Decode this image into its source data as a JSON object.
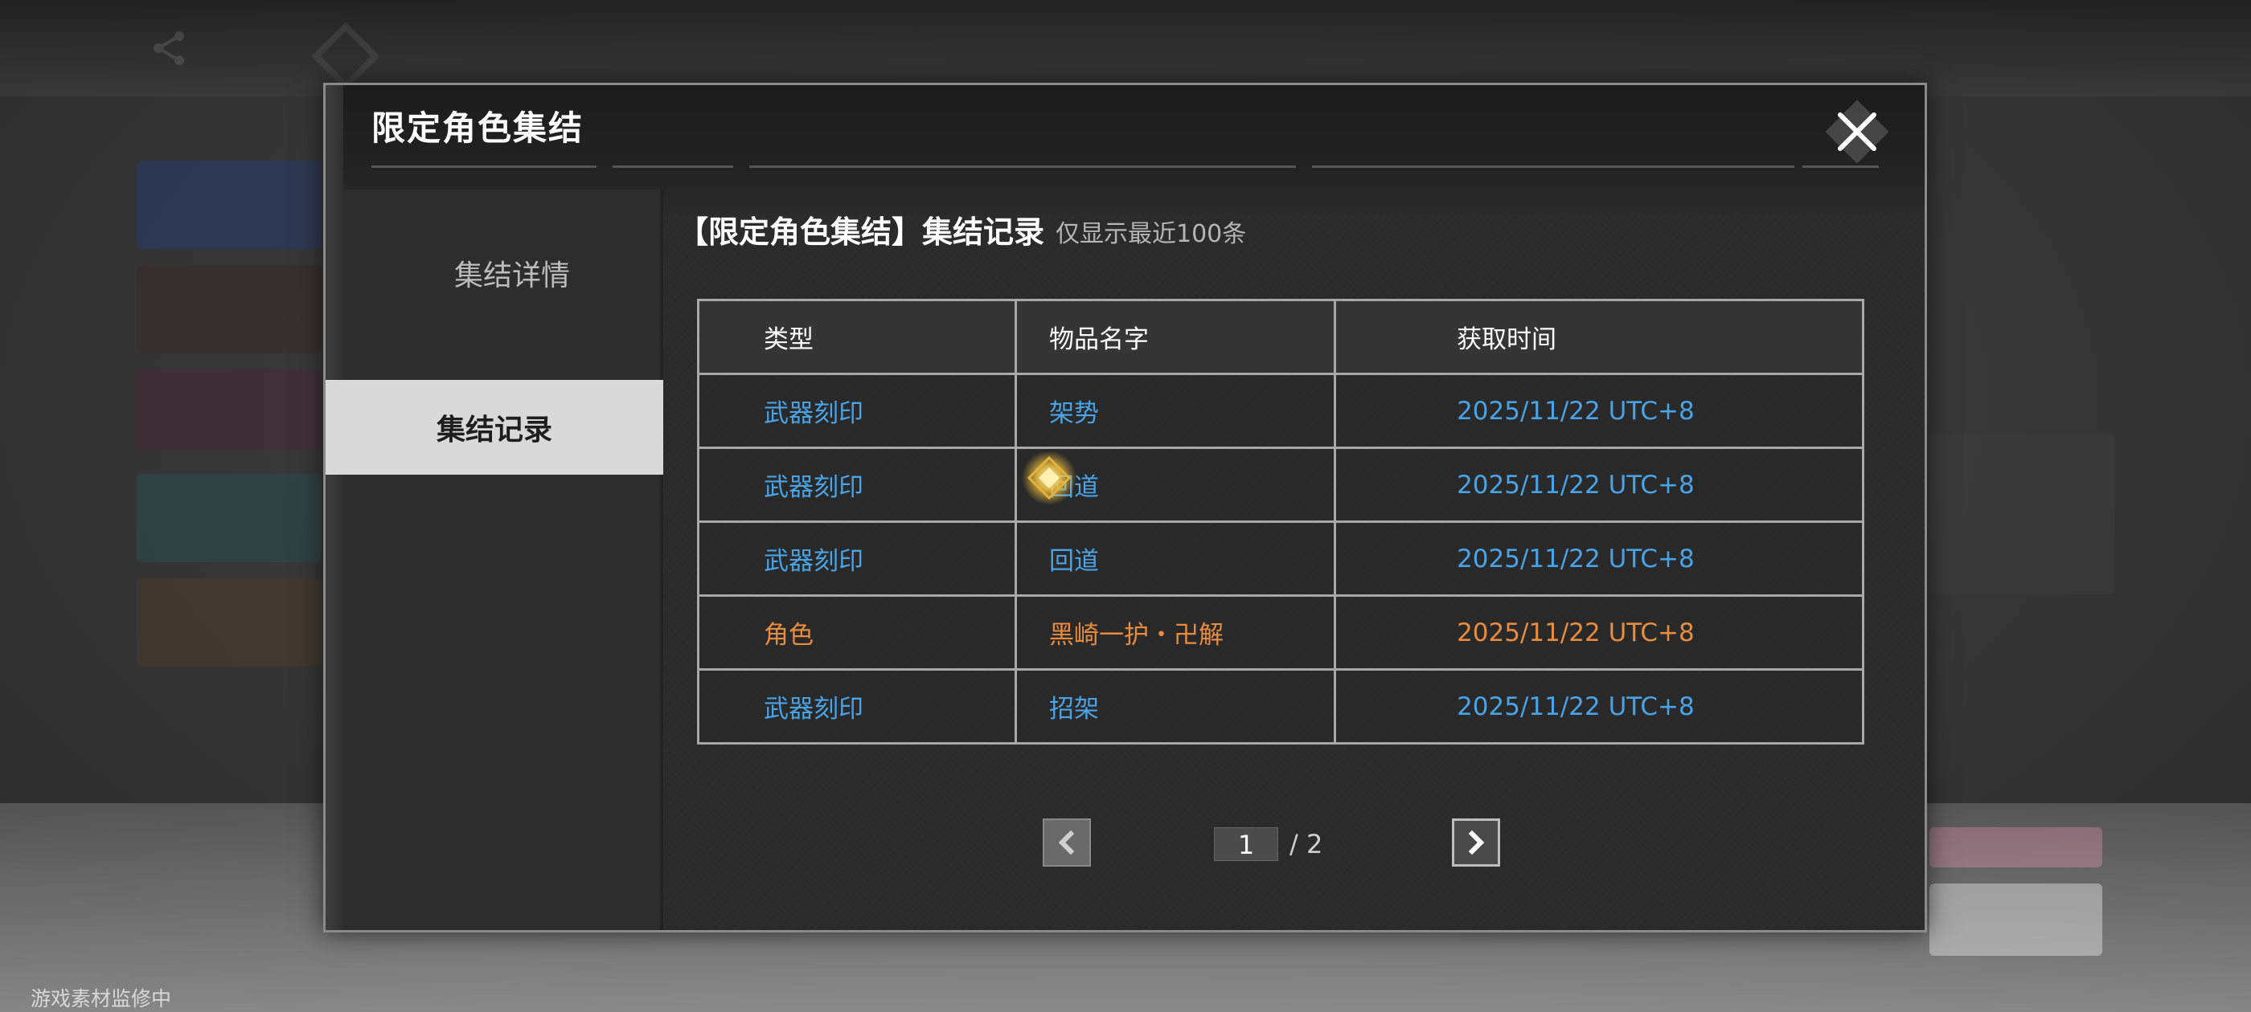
{
  "modal": {
    "title": "限定角色集结"
  },
  "sidebar": {
    "items": [
      {
        "label": "集结详情"
      },
      {
        "label": "集结记录"
      }
    ]
  },
  "records": {
    "title": "【限定角色集结】集结记录",
    "subtitle": "仅显示最近100条",
    "columns": [
      "类型",
      "物品名字",
      "获取时间"
    ],
    "rows": [
      {
        "type": "武器刻印",
        "name": "架势",
        "time": "2025/11/22 UTC+8",
        "color": "#4aa3e6"
      },
      {
        "type": "武器刻印",
        "name": "回道",
        "time": "2025/11/22 UTC+8",
        "color": "#4aa3e6"
      },
      {
        "type": "武器刻印",
        "name": "回道",
        "time": "2025/11/22 UTC+8",
        "color": "#4aa3e6"
      },
      {
        "type": "角色",
        "name": "黑崎一护・卍解",
        "time": "2025/11/22 UTC+8",
        "color": "#e88c3f"
      },
      {
        "type": "武器刻印",
        "name": "招架",
        "time": "2025/11/22 UTC+8",
        "color": "#4aa3e6"
      }
    ]
  },
  "pagination": {
    "current": "1",
    "total": "/ 2"
  },
  "footer": {
    "note": "游戏素材监修中"
  },
  "icons": {
    "close": "close-icon",
    "prev": "chevron-left-icon",
    "next": "chevron-right-icon",
    "sparkle": "sparkle-icon"
  }
}
